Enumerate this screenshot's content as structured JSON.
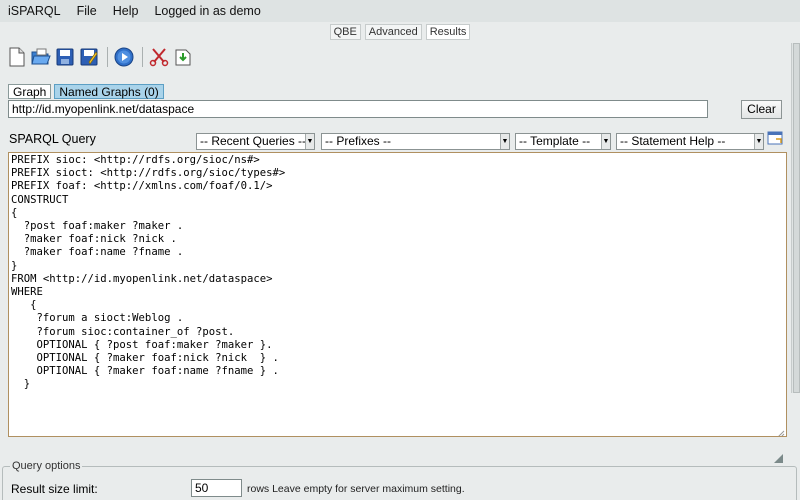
{
  "menu": {
    "app_name": "iSPARQL",
    "file": "File",
    "help": "Help",
    "login_status": "Logged in as demo"
  },
  "view_tabs": [
    {
      "label": "QBE",
      "active": false
    },
    {
      "label": "Advanced",
      "active": false
    },
    {
      "label": "Results",
      "active": true
    }
  ],
  "toolbar": {
    "icons": [
      "new-document-icon",
      "open-folder-icon",
      "save-icon",
      "save-as-icon",
      "execute-query-icon",
      "cut-icon",
      "export-icon"
    ]
  },
  "graph_tabs": {
    "graph": "Graph",
    "named_graphs": "Named Graphs (0)"
  },
  "dataset": {
    "url": "http://id.myopenlink.net/dataspace",
    "clear_label": "Clear"
  },
  "query": {
    "label": "SPARQL Query",
    "recent_queries": "-- Recent Queries --",
    "prefixes": "-- Prefixes --",
    "template": "-- Template --",
    "statement_help": "-- Statement Help --",
    "text": "PREFIX sioc: <http://rdfs.org/sioc/ns#>\nPREFIX sioct: <http://rdfs.org/sioc/types#>\nPREFIX foaf: <http://xmlns.com/foaf/0.1/>\nCONSTRUCT\n{\n  ?post foaf:maker ?maker .\n  ?maker foaf:nick ?nick .\n  ?maker foaf:name ?fname .\n}\nFROM <http://id.myopenlink.net/dataspace>\nWHERE\n   {\n    ?forum a sioct:Weblog .\n    ?forum sioc:container_of ?post.\n    OPTIONAL { ?post foaf:maker ?maker }.\n    OPTIONAL { ?maker foaf:nick ?nick  } .\n    OPTIONAL { ?maker foaf:name ?fname } .\n  }"
  },
  "query_options": {
    "legend": "Query options",
    "result_size_label": "Result size limit:",
    "result_size_value": "50",
    "result_size_note": "rows Leave empty for server maximum setting."
  },
  "colors": {
    "background": "#e9ecec",
    "named_graph_tab": "#a9d3ea",
    "editor_border": "#b09060"
  }
}
